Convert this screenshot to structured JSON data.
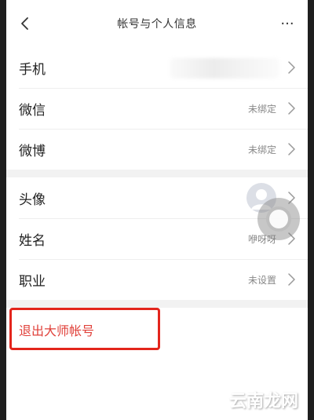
{
  "header": {
    "title": "帐号与个人信息",
    "more_label": "···"
  },
  "bindings": {
    "rows": [
      {
        "label": "手机",
        "value": ""
      },
      {
        "label": "微信",
        "value": "未绑定"
      },
      {
        "label": "微博",
        "value": "未绑定"
      }
    ]
  },
  "profile": {
    "rows": [
      {
        "label": "头像",
        "value": ""
      },
      {
        "label": "姓名",
        "value": "咿呀呀"
      },
      {
        "label": "职业",
        "value": "未设置"
      }
    ]
  },
  "logout": {
    "label": "退出大师帐号"
  },
  "watermark": {
    "text": "云南龙网"
  },
  "colors": {
    "logout_text": "#e0413a",
    "highlight_border": "#e3251c",
    "section_separator": "#f2f2f2"
  }
}
